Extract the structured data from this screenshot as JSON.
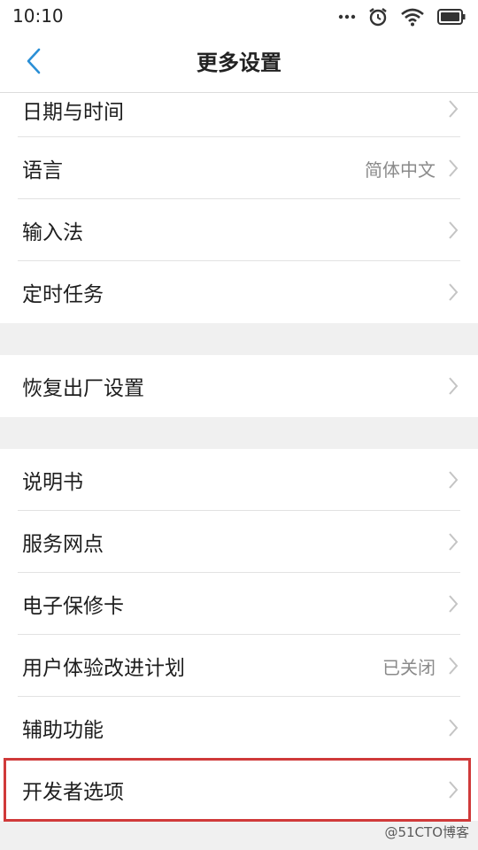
{
  "status_bar": {
    "time": "10:10",
    "icons": [
      "more-dots-icon",
      "alarm-icon",
      "wifi-icon",
      "battery-icon"
    ]
  },
  "app_bar": {
    "title": "更多设置",
    "back_icon": "chevron-left-icon"
  },
  "colors": {
    "accent": "#2a8fd6",
    "highlight_border": "#d03a3a",
    "background": "#f0f0f0"
  },
  "groups": [
    {
      "items": [
        {
          "label": "日期与时间",
          "value": ""
        },
        {
          "label": "语言",
          "value": "简体中文"
        },
        {
          "label": "输入法",
          "value": ""
        },
        {
          "label": "定时任务",
          "value": ""
        }
      ]
    },
    {
      "items": [
        {
          "label": "恢复出厂设置",
          "value": ""
        }
      ]
    },
    {
      "items": [
        {
          "label": "说明书",
          "value": ""
        },
        {
          "label": "服务网点",
          "value": ""
        },
        {
          "label": "电子保修卡",
          "value": ""
        },
        {
          "label": "用户体验改进计划",
          "value": "已关闭"
        },
        {
          "label": "辅助功能",
          "value": ""
        },
        {
          "label": "开发者选项",
          "value": ""
        }
      ]
    }
  ],
  "watermark": "@51CTO博客"
}
